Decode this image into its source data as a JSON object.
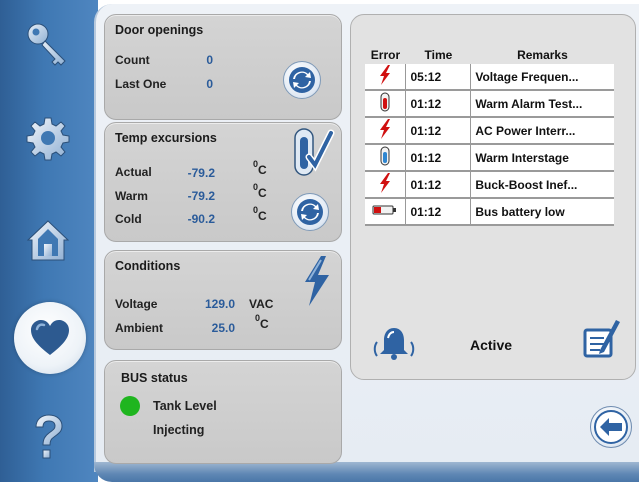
{
  "sidebar": {
    "items": [
      {
        "name": "key-icon"
      },
      {
        "name": "gear-icon"
      },
      {
        "name": "home-icon"
      },
      {
        "name": "heart-icon",
        "selected": true
      },
      {
        "name": "help-icon"
      }
    ]
  },
  "door_openings": {
    "title": "Door openings",
    "count_label": "Count",
    "count_value": "0",
    "last_label": "Last One",
    "last_value": "0"
  },
  "temp_excursions": {
    "title": "Temp excursions",
    "rows": [
      {
        "label": "Actual",
        "value": "-79.2",
        "unit_sup": "0",
        "unit": "C"
      },
      {
        "label": "Warm",
        "value": "-79.2",
        "unit_sup": "0",
        "unit": "C"
      },
      {
        "label": "Cold",
        "value": "-90.2",
        "unit_sup": "0",
        "unit": "C"
      }
    ]
  },
  "conditions": {
    "title": "Conditions",
    "voltage_label": "Voltage",
    "voltage_value": "129.0",
    "voltage_unit": "VAC",
    "ambient_label": "Ambient",
    "ambient_value": "25.0",
    "ambient_unit_sup": "0",
    "ambient_unit": "C"
  },
  "bus_status": {
    "title": "BUS status",
    "indicator_color": "#1fb51f",
    "tank_level": "Tank Level",
    "state": "Injecting"
  },
  "error_log": {
    "headers": {
      "error": "Error",
      "time": "Time",
      "remarks": "Remarks"
    },
    "rows": [
      {
        "icon": "lightning-icon",
        "time": "05:12",
        "remark": "Voltage Frequen..."
      },
      {
        "icon": "thermometer-red-icon",
        "time": "01:12",
        "remark": "Warm Alarm Test..."
      },
      {
        "icon": "lightning-icon",
        "time": "01:12",
        "remark": "AC Power Interr..."
      },
      {
        "icon": "thermometer-blue-icon",
        "time": "01:12",
        "remark": "Warm Interstage"
      },
      {
        "icon": "lightning-icon",
        "time": "01:12",
        "remark": "Buck-Boost Inef..."
      },
      {
        "icon": "battery-icon",
        "time": "01:12",
        "remark": "Bus battery low"
      }
    ],
    "status": "Active"
  },
  "colors": {
    "sidebar_blue": "#3f78b3",
    "value_blue": "#2a5b9a",
    "error_red": "#d01010"
  }
}
